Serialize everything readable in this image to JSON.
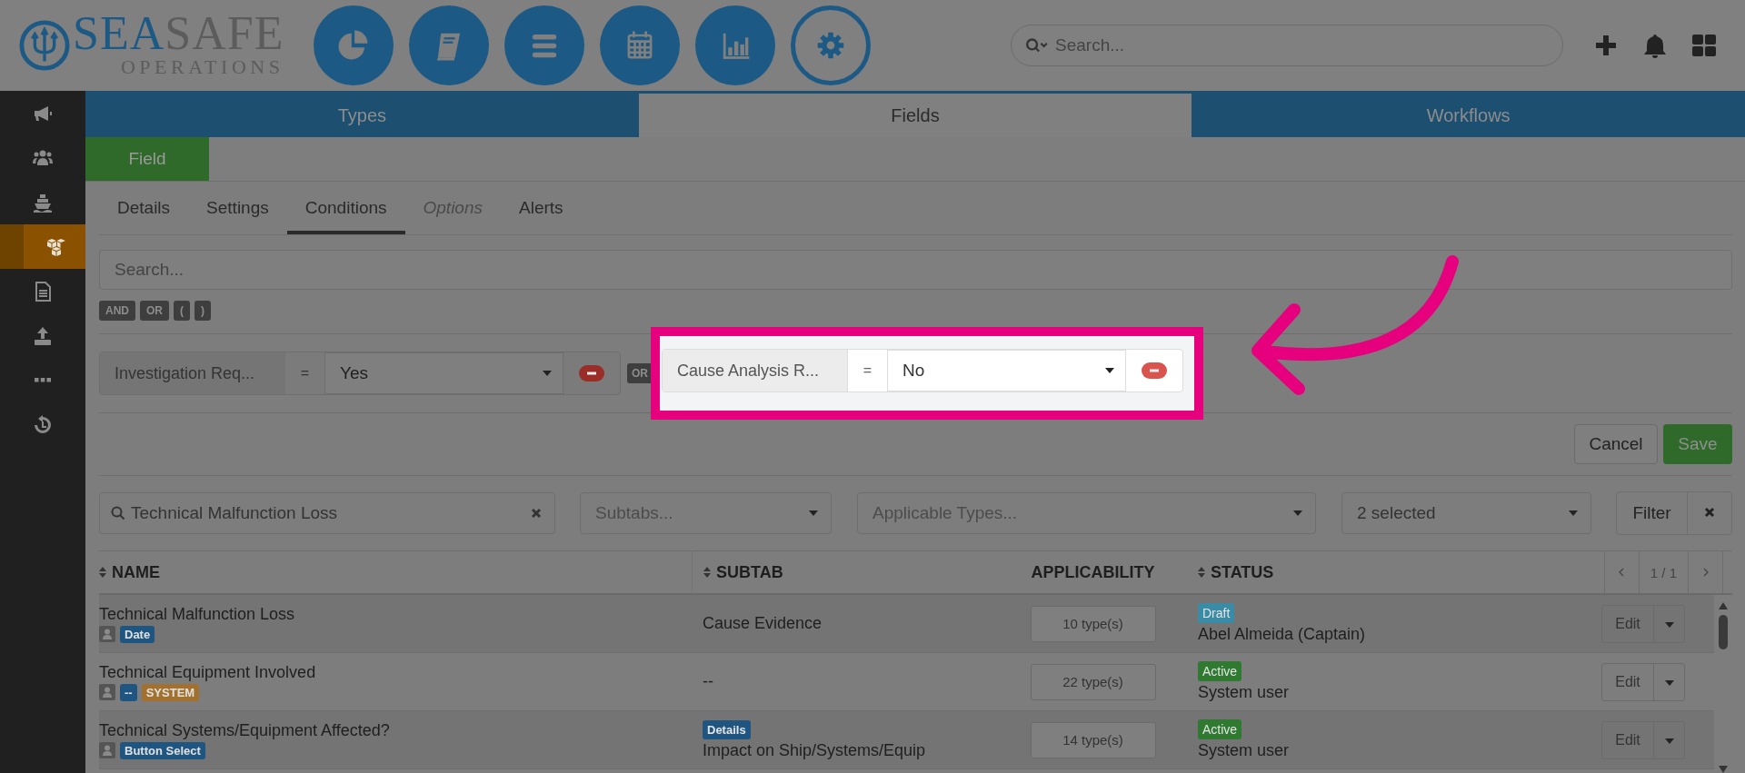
{
  "logo": {
    "brand_first": "SEA",
    "brand_second": "SAFE",
    "subtitle": "OPERATIONS"
  },
  "nav_buttons": [
    {
      "kind": "pie",
      "selected": false
    },
    {
      "kind": "book",
      "selected": false
    },
    {
      "kind": "list",
      "selected": false
    },
    {
      "kind": "calendar",
      "selected": false
    },
    {
      "kind": "bars",
      "selected": false
    },
    {
      "kind": "gear",
      "selected": true
    }
  ],
  "header_search": {
    "placeholder": "Search..."
  },
  "header_icons": [
    {
      "kind": "plus"
    },
    {
      "kind": "bell"
    },
    {
      "kind": "grid"
    }
  ],
  "sidebar": {
    "items": [
      {
        "kind": "megaphone",
        "selected": false
      },
      {
        "kind": "people",
        "selected": false
      },
      {
        "kind": "ship",
        "selected": false
      },
      {
        "kind": "boxes",
        "selected": true
      },
      {
        "kind": "document",
        "selected": false
      },
      {
        "kind": "upload",
        "selected": false
      },
      {
        "kind": "dots",
        "selected": false
      },
      {
        "kind": "history",
        "selected": false
      }
    ]
  },
  "tabs": [
    {
      "label": "Types",
      "selected": false
    },
    {
      "label": "Fields",
      "selected": true
    },
    {
      "label": "Workflows",
      "selected": false
    }
  ],
  "section_tab": {
    "label": "Field"
  },
  "subtabs": [
    {
      "label": "Details",
      "selected": false,
      "disabled": false
    },
    {
      "label": "Settings",
      "selected": false,
      "disabled": false
    },
    {
      "label": "Conditions",
      "selected": true,
      "disabled": false
    },
    {
      "label": "Options",
      "selected": false,
      "disabled": true
    },
    {
      "label": "Alerts",
      "selected": false,
      "disabled": false
    }
  ],
  "condition_search": {
    "placeholder": "Search..."
  },
  "operators": [
    "AND",
    "OR",
    "(",
    ")"
  ],
  "conditions": [
    {
      "field": "Investigation Req...",
      "operator": "=",
      "value": "Yes",
      "highlighted": false
    },
    {
      "connector": "OR",
      "field": "Cause Analysis R...",
      "operator": "=",
      "value": "No",
      "highlighted": true
    }
  ],
  "actions": {
    "cancel": "Cancel",
    "save": "Save"
  },
  "filters": {
    "search": "Technical Malfunction Loss",
    "subtabs_placeholder": "Subtabs...",
    "types_placeholder": "Applicable Types...",
    "status": "2 selected",
    "filter": "Filter"
  },
  "table": {
    "columns": [
      {
        "label": "NAME",
        "sortable": true
      },
      {
        "label": "SUBTAB",
        "sortable": true
      },
      {
        "label": "APPLICABILITY",
        "sortable": false
      },
      {
        "label": "STATUS",
        "sortable": true
      }
    ],
    "pager": "1 / 1",
    "rows": [
      {
        "name": "Technical Malfunction Loss",
        "tags": [
          {
            "label": "Date",
            "color": "#1f5581"
          }
        ],
        "subtab": "Cause Evidence",
        "applicability": "10 type(s)",
        "status": {
          "label": "Draft",
          "color": "#3a8ba6"
        },
        "user": "Abel Almeida (Captain)",
        "action": "Edit"
      },
      {
        "name": "Technical Equipment Involved",
        "tags": [
          {
            "label": "--",
            "color": "#1f5581"
          },
          {
            "label": "SYSTEM",
            "color": "#a3712e"
          }
        ],
        "subtab": "--",
        "applicability": "22 type(s)",
        "status": {
          "label": "Active",
          "color": "#2f7a30"
        },
        "user": "System user",
        "action": "Edit"
      },
      {
        "name": "Technical Systems/Equipment Affected?",
        "tags": [
          {
            "label": "Button Select",
            "color": "#1f5581"
          }
        ],
        "subtab_badge": "Details",
        "subtab": "Impact on Ship/Systems/Equip",
        "applicability": "14 type(s)",
        "status": {
          "label": "Active",
          "color": "#2f7a30"
        },
        "user": "System user",
        "action": "Edit"
      }
    ]
  }
}
